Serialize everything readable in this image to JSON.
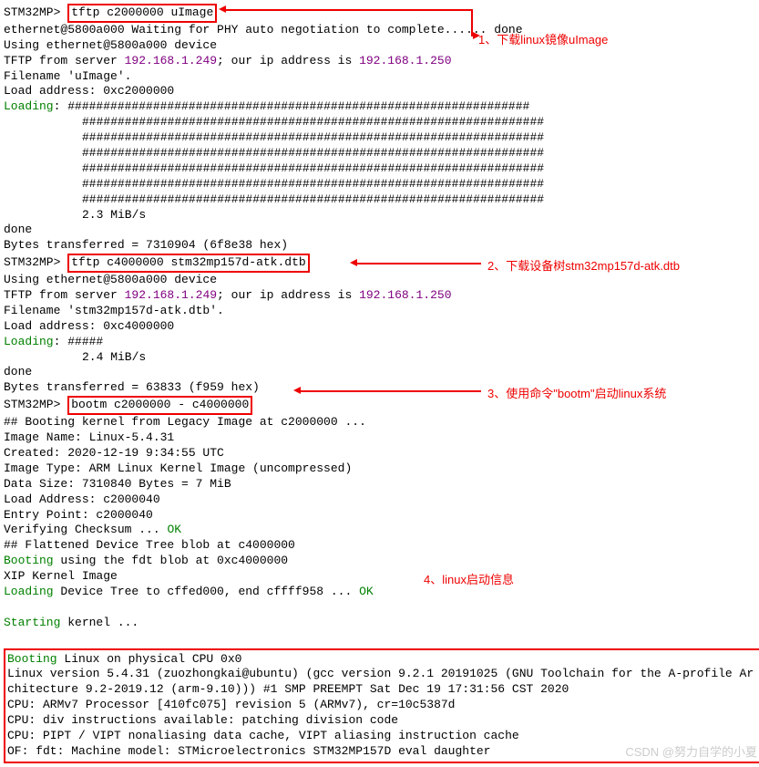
{
  "prompt": "STM32MP>",
  "cmd1": "tftp c2000000 uImage",
  "l1": "ethernet@5800a000 Waiting for PHY auto negotiation to complete...... done",
  "l2": "Using ethernet@5800a000 device",
  "l3a": "TFTP from server ",
  "ip1": "192.168.1.249",
  "l3b": "; our ip address is ",
  "ip2": "192.168.1.250",
  "l4": "Filename 'uImage'.",
  "l5": "Load address: 0xc2000000",
  "loading": "Loading",
  "hash": "#################################################################",
  "speed1": "2.3 MiB/s",
  "done": "done",
  "l6": "Bytes transferred = 7310904 (6f8e38 hex)",
  "cmd2": "tftp c4000000 stm32mp157d-atk.dtb",
  "l7": "Filename 'stm32mp157d-atk.dtb'.",
  "l8": "Load address: 0xc4000000",
  "hash2": "#####",
  "speed2": "2.4 MiB/s",
  "l9": "Bytes transferred = 63833 (f959 hex)",
  "cmd3": "bootm c2000000 - c4000000",
  "l10": "## Booting kernel from Legacy Image at c2000000 ...",
  "l11a": "   Image Name:   Linux-5.4.31",
  "l11b": "   Created:      2020-12-19   9:34:55 UTC",
  "l11c": "   Image Type:   ARM Linux Kernel Image (uncompressed)",
  "l11d": "   Data Size:    7310840 Bytes = 7 MiB",
  "l11e": "   Load Address: c2000040",
  "l11f": "   Entry Point:  c2000040",
  "l11g": "   Verifying Checksum ... ",
  "ok": "OK",
  "l12": "## Flattened Device Tree blob at c4000000",
  "booting": "Booting",
  "l13": " using the fdt blob at 0xc4000000",
  "l14": "   XIP Kernel Image",
  "l15a": " Device Tree to cffed000, end cffff958 ... ",
  "starting": "Starting",
  "l16": " kernel ...",
  "b1": " Linux on physical CPU 0x0",
  "b2": "Linux version 5.4.31 (zuozhongkai@ubuntu) (gcc version 9.2.1 20191025 (GNU Toolchain for the A-profile Architecture 9.2-2019.12 (arm-9.10))) #1 SMP PREEMPT Sat Dec 19 17:31:56 CST 2020",
  "b3": "CPU: ARMv7 Processor [410fc075] revision 5 (ARMv7), cr=10c5387d",
  "b4": "CPU: div instructions available: patching division code",
  "b5": "CPU: PIPT / VIPT nonaliasing data cache, VIPT aliasing instruction cache",
  "b6": "OF: fdt: Machine model: STMicroelectronics STM32MP157D eval daughter",
  "anno1": "1、下载linux镜像uImage",
  "anno2": "2、下载设备树stm32mp157d-atk.dtb",
  "anno3": "3、使用命令\"bootm\"启动linux系统",
  "anno4": "4、linux启动信息",
  "wm": "CSDN @努力自学的小夏"
}
